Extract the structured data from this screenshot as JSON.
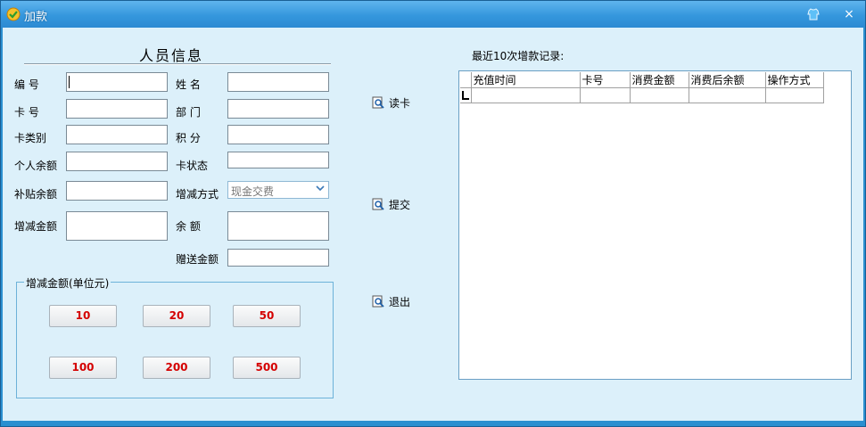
{
  "window": {
    "title": "加款",
    "skin_icon": "shirt-icon",
    "close_label": "×"
  },
  "left": {
    "section_title": "人员信息",
    "labels": {
      "card_no": "编 号",
      "name": "姓 名",
      "card": "卡 号",
      "dept": "部 门",
      "card_type": "卡类别",
      "points": "积 分",
      "personal_balance": "个人余额",
      "card_status": "卡状态",
      "subsidy_balance": "补贴余额",
      "adjust_method": "增减方式",
      "adjust_amount": "增减金额",
      "balance": "余 额",
      "gift_amount": "赠送金额"
    },
    "fields": {
      "card_no": "",
      "name": "",
      "card": "",
      "dept": "",
      "card_type": "",
      "points": "",
      "personal_balance": "",
      "card_status": "",
      "subsidy_balance": "",
      "adjust_amount": "",
      "balance": "",
      "gift_amount": ""
    },
    "adjust_method_value": "现金交费",
    "group": {
      "title": "增减金额(单位元)",
      "amounts": [
        "10",
        "20",
        "50",
        "100",
        "200",
        "500"
      ]
    }
  },
  "actions": {
    "read_card": "读卡",
    "submit": "提交",
    "exit": "退出"
  },
  "records": {
    "caption": "最近10次增款记录:",
    "columns": [
      "充值时间",
      "卡号",
      "消费金额",
      "消费后余额",
      "操作方式"
    ],
    "rows": []
  },
  "colors": {
    "title_bar": "#3597dd",
    "client_bg": "#dcf0fa",
    "amount_text": "#d40000"
  }
}
